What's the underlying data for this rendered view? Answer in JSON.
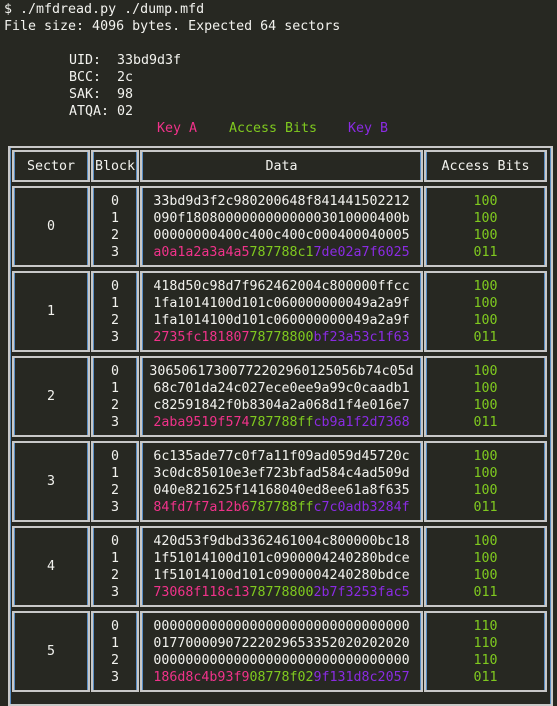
{
  "terminal": {
    "command": "$ ./mfdread.py ./dump.mfd",
    "file_info": "File size: 4096 bytes. Expected 64 sectors"
  },
  "card_info": {
    "uid_label": "UID:",
    "uid": "33bd9d3f",
    "bcc_label": "BCC:",
    "bcc": "2c",
    "sak_label": "SAK:",
    "sak": "98",
    "atqa_label": "ATQA:",
    "atqa": "02"
  },
  "legend": {
    "key_a": "Key A",
    "access_bits": "Access Bits",
    "key_b": "Key B",
    "colors": {
      "key_a": "#f0328a",
      "access_bits": "#7fc91f",
      "key_b": "#8a2be2"
    }
  },
  "table": {
    "headers": [
      "Sector",
      "Block",
      "Data",
      "Access Bits"
    ],
    "sectors": [
      {
        "sector": "0",
        "blocks": [
          "0",
          "1",
          "2",
          "3"
        ],
        "data": [
          "33bd9d3f2c980200648f841441502212",
          "090f180800000000000003010000400b",
          "00000000400c400c400c000400040005"
        ],
        "trailer": {
          "key_a": "a0a1a2a3a4a5",
          "access": "787788c1",
          "key_b": "7de02a7f6025"
        },
        "access_bits": [
          "100",
          "100",
          "100",
          "011"
        ]
      },
      {
        "sector": "1",
        "blocks": [
          "0",
          "1",
          "2",
          "3"
        ],
        "data": [
          "418d50c98d7f962462004c800000ffcc",
          "1fa1014100d101c060000000049a2a9f",
          "1fa1014100d101c060000000049a2a9f"
        ],
        "trailer": {
          "key_a": "2735fc181807",
          "access": "78778800",
          "key_b": "bf23a53c1f63"
        },
        "access_bits": [
          "100",
          "100",
          "100",
          "011"
        ]
      },
      {
        "sector": "2",
        "blocks": [
          "0",
          "1",
          "2",
          "3"
        ],
        "data": [
          "30650617300772202960125056b74c05d",
          "68c701da24c027ece0ee9a99c0caadb1",
          "c82591842f0b8304a2a068d1f4e016e7"
        ],
        "trailer": {
          "key_a": "2aba9519f574",
          "access": "787788ff",
          "key_b": "cb9a1f2d7368"
        },
        "access_bits": [
          "100",
          "100",
          "100",
          "011"
        ]
      },
      {
        "sector": "3",
        "blocks": [
          "0",
          "1",
          "2",
          "3"
        ],
        "data": [
          "6c135ade77c0f7a11f09ad059d45720c",
          "3c0dc85010e3ef723bfad584c4ad509d",
          "040e821625f14168040ed8ee61a8f635"
        ],
        "trailer": {
          "key_a": "84fd7f7a12b6",
          "access": "787788ff",
          "key_b": "c7c0adb3284f"
        },
        "access_bits": [
          "100",
          "100",
          "100",
          "011"
        ]
      },
      {
        "sector": "4",
        "blocks": [
          "0",
          "1",
          "2",
          "3"
        ],
        "data": [
          "420d53f9dbd3362461004c800000bc18",
          "1f51014100d101c0900004240280bdce",
          "1f51014100d101c0900004240280bdce"
        ],
        "trailer": {
          "key_a": "73068f118c13",
          "access": "78778800",
          "key_b": "2b7f3253fac5"
        },
        "access_bits": [
          "100",
          "100",
          "100",
          "011"
        ]
      },
      {
        "sector": "5",
        "blocks": [
          "0",
          "1",
          "2",
          "3"
        ],
        "data": [
          "00000000000000000000000000000000",
          "01770000907222029653352020202020",
          "00000000000000000000000000000000"
        ],
        "trailer": {
          "key_a": "186d8c4b93f9",
          "access": "08778f02",
          "key_b": "9f131d8c2057"
        },
        "access_bits": [
          "110",
          "110",
          "110",
          "011"
        ]
      }
    ]
  }
}
